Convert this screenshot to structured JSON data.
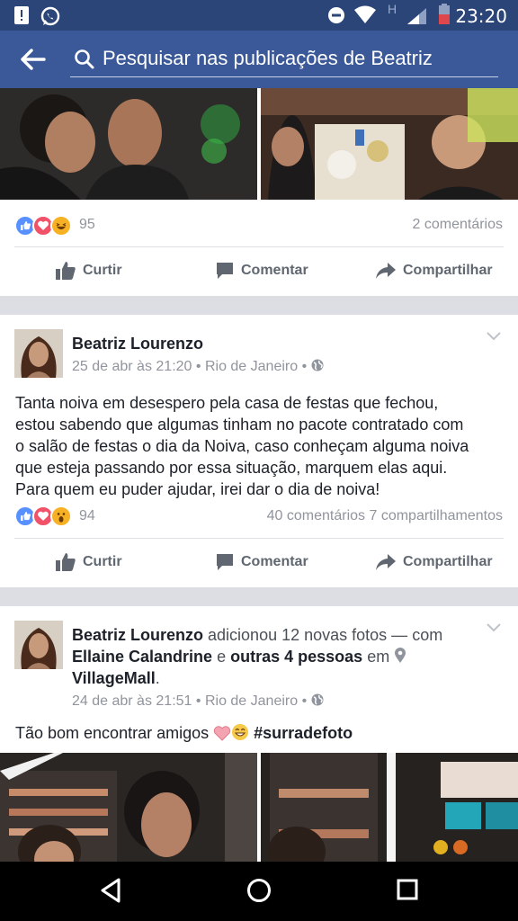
{
  "status_bar": {
    "time": "23:20",
    "network_letter": "H"
  },
  "search": {
    "placeholder": "Pesquisar nas publicações de Beatriz"
  },
  "post_top": {
    "reaction_count": "95",
    "comments": "2 comentários"
  },
  "actions": {
    "like": "Curtir",
    "comment": "Comentar",
    "share": "Compartilhar"
  },
  "post_middle": {
    "author": "Beatriz Lourenzo",
    "date": "25 de abr às 21:20",
    "place": "Rio de Janeiro",
    "sep": "•",
    "text_lines": [
      "Tanta noiva em desespero pela casa de festas que fechou,",
      "estou sabendo que algumas tinham no pacote contratado com",
      "o salão de festas o dia da Noiva, caso conheçam alguma noiva",
      "que esteja passando por essa situação, marquem elas aqui.",
      "Para quem eu puder ajudar, irei dar o dia de noiva!"
    ],
    "reaction_count": "94",
    "comments": "40 comentários",
    "shares": "7 compartilhamentos"
  },
  "post_bottom": {
    "author": "Beatriz Lourenzo",
    "added": "adicionou 12 novas fotos —",
    "with": "com",
    "tagged": "Ellaine Calandrine",
    "and": "e",
    "others": "outras 4 pessoas",
    "at": "em",
    "place_tag": "VillageMall",
    "period": ".",
    "date": "24 de abr às 21:51",
    "place": "Rio de Janeiro",
    "sep": "•",
    "text": "Tão bom encontrar amigos",
    "hashtag": "#surradefoto"
  },
  "colors": {
    "brand": "#3b5998",
    "status": "#2b4578",
    "like_blue": "#5890ff",
    "love_red": "#f25268",
    "haha_yellow": "#f7b125"
  }
}
